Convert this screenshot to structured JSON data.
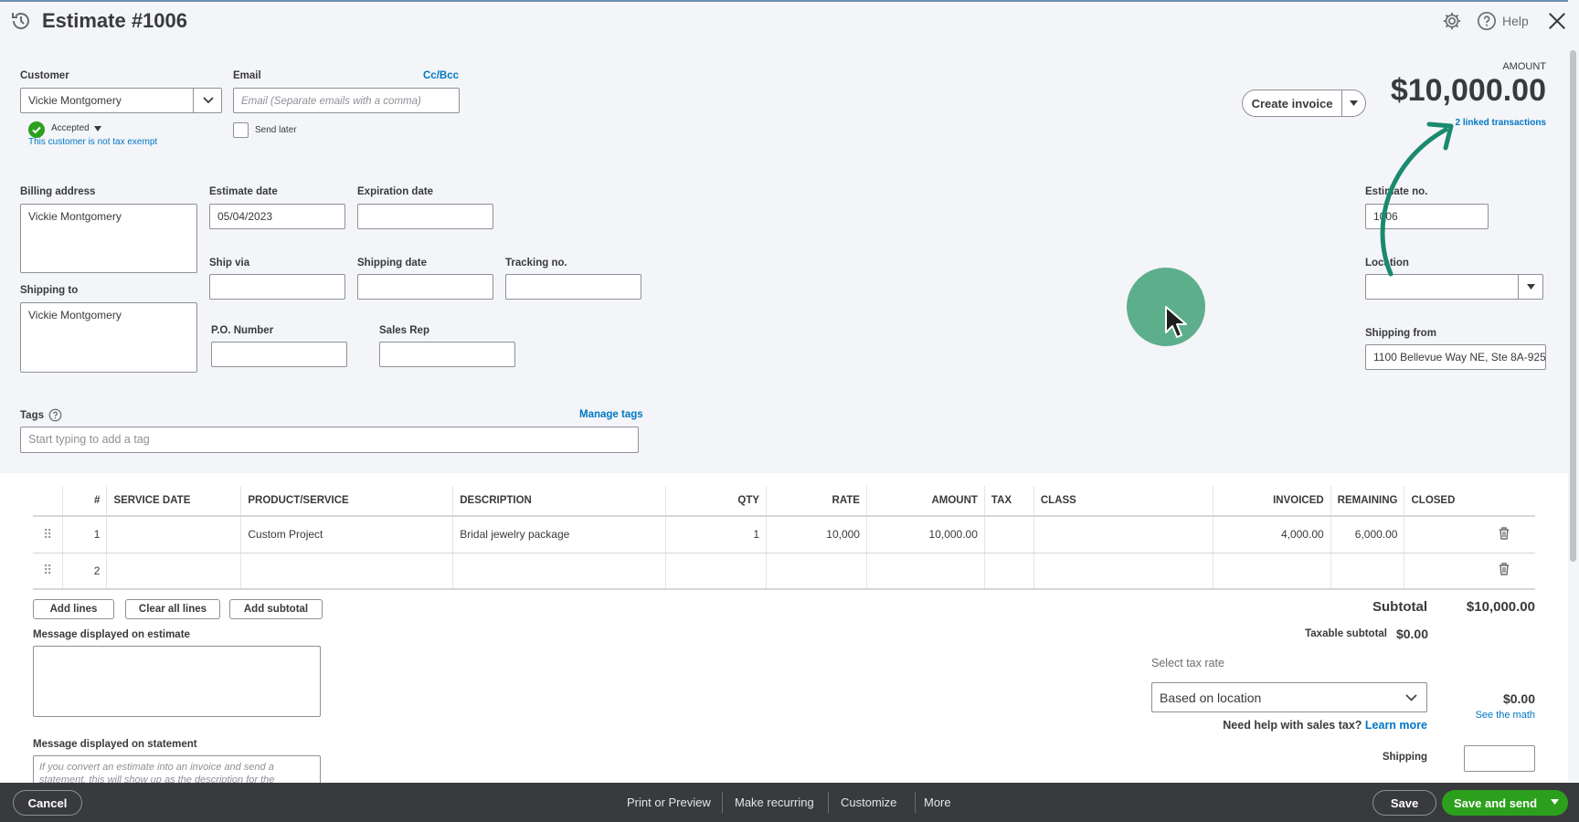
{
  "header": {
    "title": "Estimate #1006",
    "help_label": "Help",
    "icons": {
      "history": "history-icon",
      "settings": "gear-icon",
      "help": "help-circle-icon",
      "close": "close-icon"
    }
  },
  "customer": {
    "label": "Customer",
    "value": "Vickie Montgomery",
    "status": "Accepted",
    "tax_note": "This customer is not tax exempt"
  },
  "email": {
    "label": "Email",
    "cc_bcc": "Cc/Bcc",
    "placeholder": "Email (Separate emails with a comma)",
    "send_later": "Send later"
  },
  "amount": {
    "label": "AMOUNT",
    "value": "$10,000.00",
    "linked": "2 linked transactions",
    "create_invoice": "Create invoice"
  },
  "form": {
    "billing_address_label": "Billing address",
    "billing_address": "Vickie Montgomery",
    "shipping_to_label": "Shipping to",
    "shipping_to": "Vickie Montgomery",
    "estimate_date_label": "Estimate date",
    "estimate_date": "05/04/2023",
    "expiration_date_label": "Expiration date",
    "expiration_date": "",
    "ship_via_label": "Ship via",
    "shipping_date_label": "Shipping date",
    "tracking_no_label": "Tracking no.",
    "po_number_label": "P.O. Number",
    "sales_rep_label": "Sales Rep",
    "estimate_no_label": "Estimate no.",
    "estimate_no": "1006",
    "location_label": "Location",
    "shipping_from_label": "Shipping from",
    "shipping_from": "1100 Bellevue Way NE, Ste 8A-925"
  },
  "tags": {
    "label": "Tags",
    "manage": "Manage tags",
    "placeholder": "Start typing to add a tag"
  },
  "table": {
    "columns": [
      "#",
      "SERVICE DATE",
      "PRODUCT/SERVICE",
      "DESCRIPTION",
      "QTY",
      "RATE",
      "AMOUNT",
      "TAX",
      "CLASS",
      "INVOICED",
      "REMAINING",
      "CLOSED"
    ],
    "rows": [
      {
        "num": "1",
        "service_date": "",
        "product": "Custom Project",
        "description": "Bridal jewelry package",
        "qty": "1",
        "rate": "10,000",
        "amount": "10,000.00",
        "tax": "",
        "class": "",
        "invoiced": "4,000.00",
        "remaining": "6,000.00",
        "closed": ""
      },
      {
        "num": "2",
        "service_date": "",
        "product": "",
        "description": "",
        "qty": "",
        "rate": "",
        "amount": "",
        "tax": "",
        "class": "",
        "invoiced": "",
        "remaining": "",
        "closed": ""
      }
    ],
    "add_lines": "Add lines",
    "clear_all_lines": "Clear all lines",
    "add_subtotal": "Add subtotal"
  },
  "messages": {
    "estimate_label": "Message displayed on estimate",
    "statement_label": "Message displayed on statement",
    "statement_placeholder": "If you convert an estimate into an invoice and send a statement, this will show up as the description for the"
  },
  "totals": {
    "subtotal_label": "Subtotal",
    "subtotal": "$10,000.00",
    "taxable_label": "Taxable subtotal",
    "taxable": "$0.00",
    "select_tax_label": "Select tax rate",
    "tax_rate": "Based on location",
    "tax_amount": "$0.00",
    "see_math": "See the math",
    "help_text": "Need help with sales tax?",
    "learn_more": "Learn more",
    "shipping_label": "Shipping"
  },
  "footer": {
    "cancel": "Cancel",
    "print": "Print or Preview",
    "recurring": "Make recurring",
    "customize": "Customize",
    "more": "More",
    "save": "Save",
    "save_send": "Save and send"
  },
  "colors": {
    "brand_green": "#2ca01c",
    "link_blue": "#0077c5",
    "arrow_teal": "#1a8a6e",
    "footer_bg": "#393a3d"
  }
}
